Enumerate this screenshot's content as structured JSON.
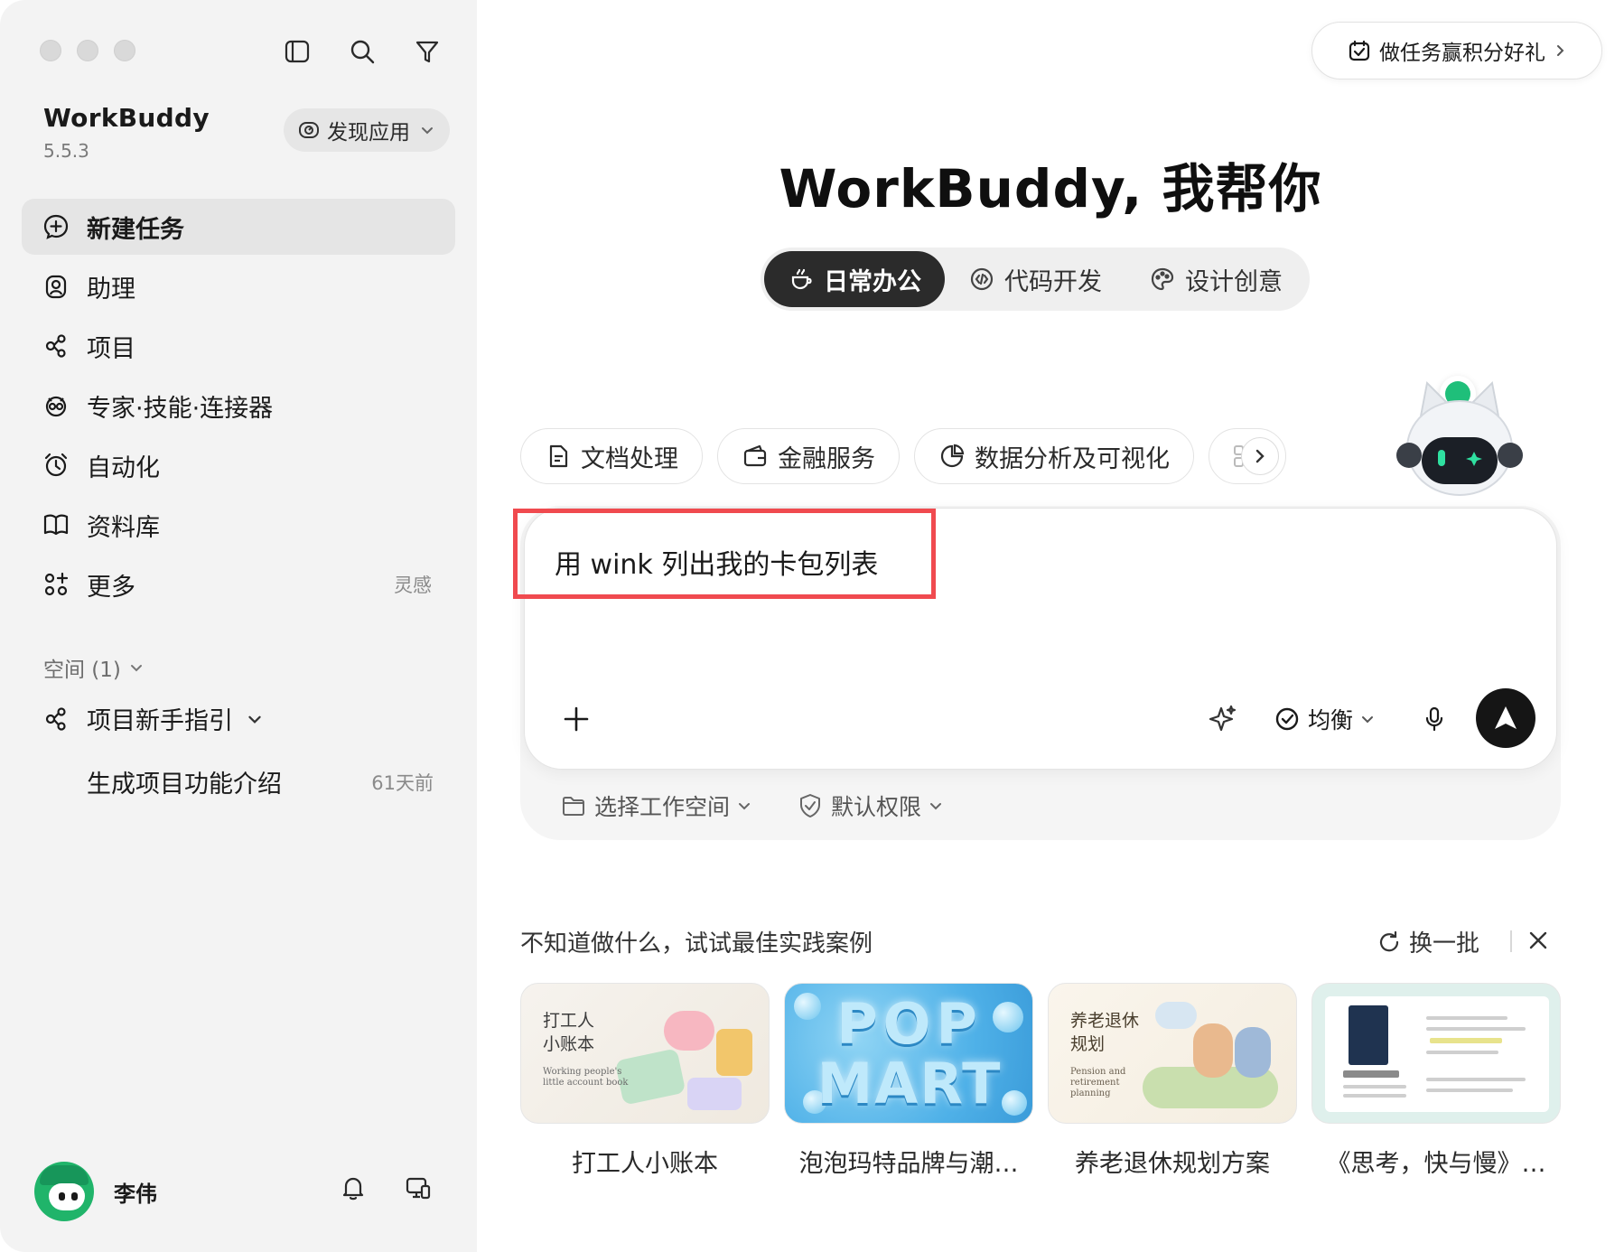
{
  "sidebar": {
    "brand_name": "WorkBuddy",
    "version": "5.5.3",
    "discover_label": "发现应用",
    "nav": [
      {
        "label": "新建任务",
        "icon": "new-task-icon",
        "active": true
      },
      {
        "label": "助理",
        "icon": "assistant-icon"
      },
      {
        "label": "项目",
        "icon": "project-icon"
      },
      {
        "label": "专家·技能·连接器",
        "icon": "expert-icon"
      },
      {
        "label": "自动化",
        "icon": "alarm-clock-icon"
      },
      {
        "label": "资料库",
        "icon": "book-icon"
      },
      {
        "label": "更多",
        "icon": "grid-plus-icon",
        "extra": "灵感"
      }
    ],
    "space_header": "空间 (1)",
    "project_name": "项目新手指引",
    "project_task": "生成项目功能介绍",
    "project_task_time": "61天前",
    "user_name": "李伟"
  },
  "main": {
    "reward_label": "做任务赢积分好礼",
    "headline": "WorkBuddy, 我帮你",
    "modes": [
      {
        "label": "日常办公",
        "active": true
      },
      {
        "label": "代码开发"
      },
      {
        "label": "设计创意"
      }
    ],
    "chips": [
      "文档处理",
      "金融服务",
      "数据分析及可视化"
    ],
    "prompt_text": "用 wink 列出我的卡包列表",
    "model_label": "均衡",
    "workspace_label": "选择工作空间",
    "permission_label": "默认权限",
    "cases_header": "不知道做什么，试试最佳实践案例",
    "refresh_label": "换一批",
    "cases": [
      {
        "title": "打工人小账本",
        "thumb_title_line1": "打工人",
        "thumb_title_line2": "小账本",
        "thumb_en_line1": "Working people's",
        "thumb_en_line2": "little account book"
      },
      {
        "title": "泡泡玛特品牌与潮…",
        "thumb_line1": "POP",
        "thumb_line2": "MART"
      },
      {
        "title": "养老退休规划方案",
        "thumb_title_line1": "养老退休",
        "thumb_title_line2": "规划",
        "thumb_en_line1": "Pension and",
        "thumb_en_line2": "retirement",
        "thumb_en_line3": "planning"
      },
      {
        "title": "《思考，快与慢》…"
      }
    ]
  },
  "colors": {
    "sidebar_bg": "#f3f3f3",
    "active_mode_bg": "#2b2b2b",
    "highlight_box": "#f04a4f",
    "send_button": "#151515",
    "avatar_green": "#20b46a"
  }
}
